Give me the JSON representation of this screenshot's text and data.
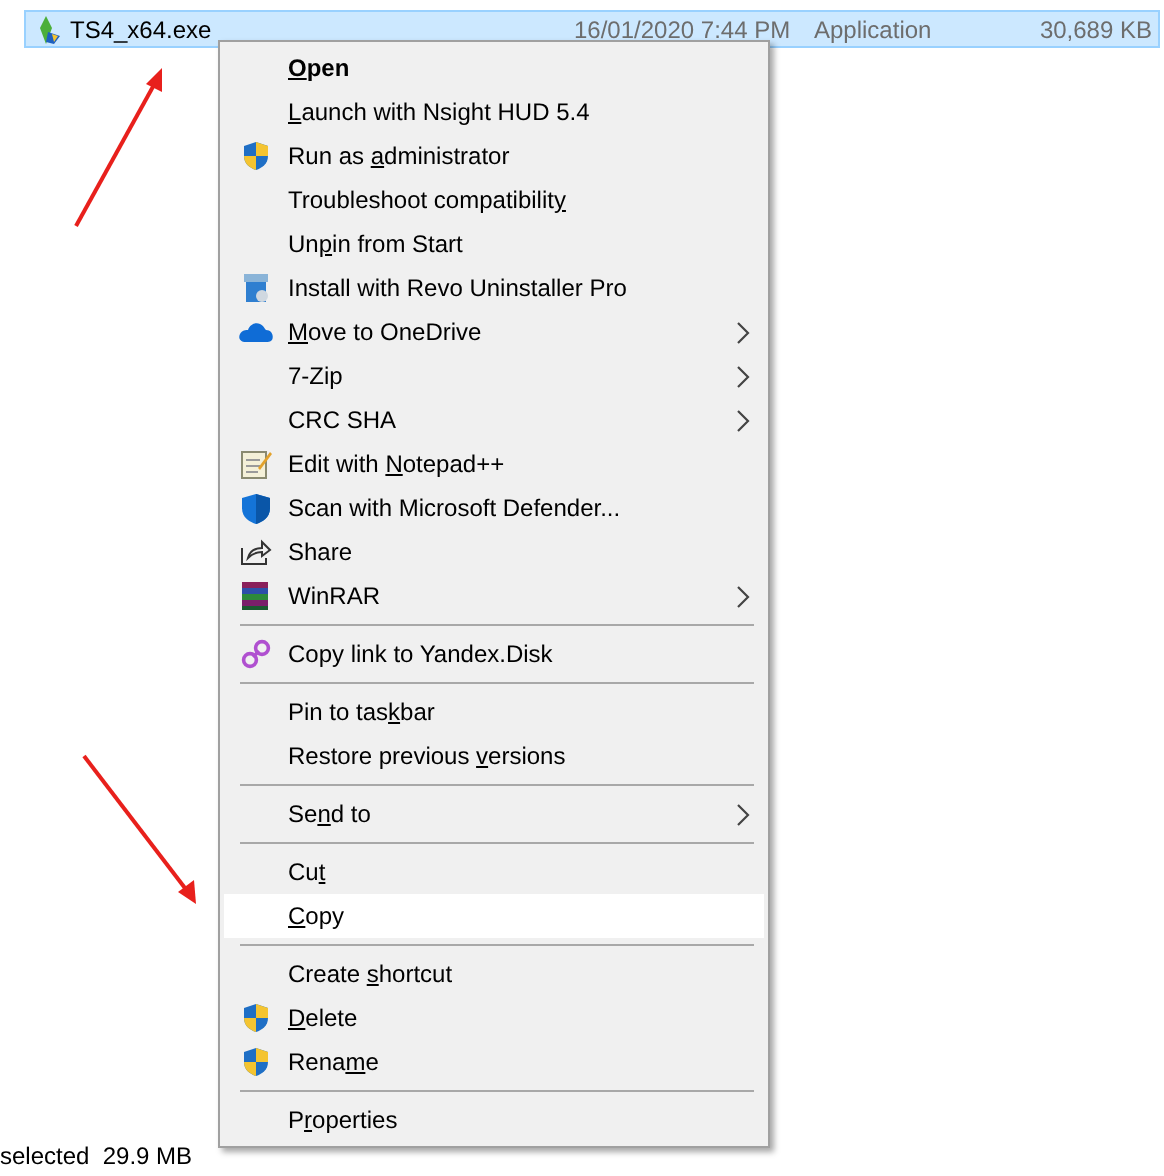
{
  "file_row": {
    "name": "TS4_x64.exe",
    "date": "16/01/2020 7:44 PM",
    "type": "Application",
    "size": "30,689 KB",
    "selected": true
  },
  "status_bar": {
    "text": "selected  29.9 MB"
  },
  "context_menu": {
    "items": [
      {
        "kind": "command",
        "key": "O",
        "post": "pen",
        "default": true,
        "selected": false,
        "has_submenu": false
      },
      {
        "kind": "command",
        "key": "L",
        "post": "aunch with Nsight HUD 5.4",
        "default": false,
        "selected": false,
        "has_submenu": false
      },
      {
        "kind": "command",
        "pre": "Run as ",
        "key": "a",
        "post": "dministrator",
        "default": false,
        "selected": false,
        "has_submenu": false
      },
      {
        "kind": "command",
        "pre": "Troubleshoot compatibilit",
        "key": "y",
        "default": false,
        "selected": false,
        "has_submenu": false
      },
      {
        "kind": "command",
        "pre": "Un",
        "key": "p",
        "post": "in from Start",
        "default": false,
        "selected": false,
        "has_submenu": false
      },
      {
        "kind": "command",
        "pre": "Install with Revo Uninstaller Pro",
        "default": false,
        "selected": false,
        "has_submenu": false
      },
      {
        "kind": "command",
        "key": "M",
        "post": "ove to OneDrive",
        "default": false,
        "selected": false,
        "has_submenu": true
      },
      {
        "kind": "command",
        "pre": "7-Zip",
        "default": false,
        "selected": false,
        "has_submenu": true
      },
      {
        "kind": "command",
        "pre": "CRC SHA",
        "default": false,
        "selected": false,
        "has_submenu": true
      },
      {
        "kind": "command",
        "pre": "Edit with ",
        "key": "N",
        "post": "otepad++",
        "default": false,
        "selected": false,
        "has_submenu": false
      },
      {
        "kind": "command",
        "pre": "Scan with Microsoft Defender...",
        "default": false,
        "selected": false,
        "has_submenu": false
      },
      {
        "kind": "command",
        "pre": "Share",
        "default": false,
        "selected": false,
        "has_submenu": false
      },
      {
        "kind": "command",
        "pre": "WinRAR",
        "default": false,
        "selected": false,
        "has_submenu": true
      },
      {
        "kind": "separator"
      },
      {
        "kind": "command",
        "pre": "Copy link to Yandex.Disk",
        "default": false,
        "selected": false,
        "has_submenu": false
      },
      {
        "kind": "separator"
      },
      {
        "kind": "command",
        "pre": "Pin to tas",
        "key": "k",
        "post": "bar",
        "default": false,
        "selected": false,
        "has_submenu": false
      },
      {
        "kind": "command",
        "pre": "Restore previous ",
        "key": "v",
        "post": "ersions",
        "default": false,
        "selected": false,
        "has_submenu": false
      },
      {
        "kind": "separator"
      },
      {
        "kind": "command",
        "pre": "Se",
        "key": "n",
        "post": "d to",
        "default": false,
        "selected": false,
        "has_submenu": true
      },
      {
        "kind": "separator"
      },
      {
        "kind": "command",
        "pre": "Cu",
        "key": "t",
        "default": false,
        "selected": false,
        "has_submenu": false
      },
      {
        "kind": "command",
        "key": "C",
        "post": "opy",
        "default": false,
        "selected": true,
        "has_submenu": false
      },
      {
        "kind": "separator"
      },
      {
        "kind": "command",
        "pre": "Create ",
        "key": "s",
        "post": "hortcut",
        "default": false,
        "selected": false,
        "has_submenu": false
      },
      {
        "kind": "command",
        "key": "D",
        "post": "elete",
        "default": false,
        "selected": false,
        "has_submenu": false
      },
      {
        "kind": "command",
        "pre": "Rena",
        "key": "m",
        "post": "e",
        "default": false,
        "selected": false,
        "has_submenu": false
      },
      {
        "kind": "separator"
      },
      {
        "kind": "command",
        "pre": "P",
        "key": "r",
        "post": "operties",
        "default": false,
        "selected": false,
        "has_submenu": false
      }
    ]
  }
}
